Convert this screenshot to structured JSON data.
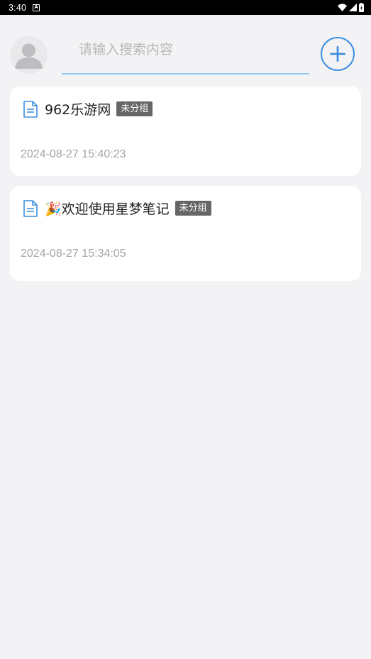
{
  "status_bar": {
    "time": "3:40",
    "notification_icon": "a-icon",
    "icons": [
      "wifi-icon",
      "signal-icon",
      "battery-icon"
    ]
  },
  "header": {
    "avatar_icon": "user-avatar-icon",
    "search": {
      "placeholder": "请输入搜索内容",
      "value": ""
    },
    "add_icon": "plus-circle-icon",
    "accent_color": "#3d8fe0"
  },
  "notes": [
    {
      "icon": "document-icon",
      "title": "962乐游网",
      "group": "未分组",
      "time": "2024-08-27 15:40:23"
    },
    {
      "icon": "document-icon",
      "title": "🎉欢迎使用星梦笔记",
      "group": "未分组",
      "time": "2024-08-27 15:34:05"
    }
  ]
}
